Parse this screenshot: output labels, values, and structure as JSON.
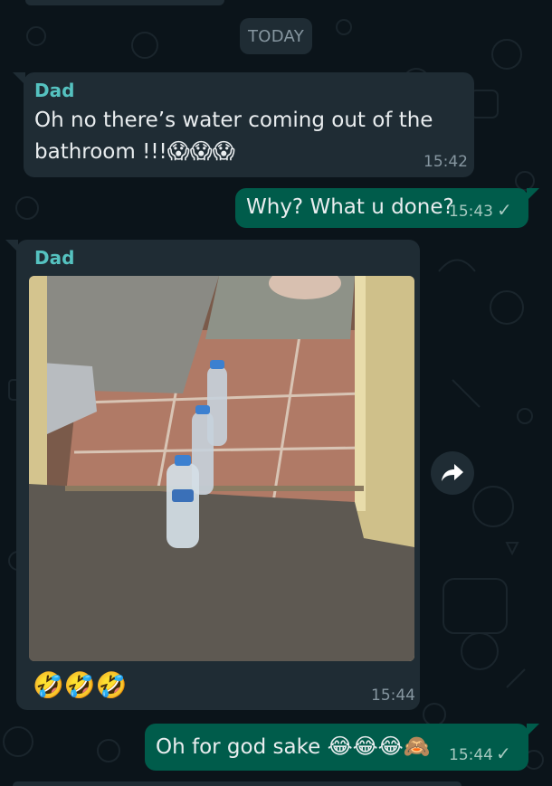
{
  "date_separator": "TODAY",
  "messages": [
    {
      "sender": "Dad",
      "text_line1": "Oh no there’s water coming out of the",
      "text_line2": "bathroom !!!",
      "emojis": "😱😱😱",
      "time": "15:42"
    },
    {
      "text": "Why? What u done?",
      "time": "15:43"
    },
    {
      "sender": "Dad",
      "photo": "image",
      "caption_emojis": "🤣🤣🤣",
      "time": "15:44"
    },
    {
      "text": "Oh for god sake",
      "emojis": "😂😂😂🙈",
      "time": "15:44"
    }
  ],
  "colors": {
    "background": "#0b141a",
    "incoming_bubble": "#1f2c34",
    "outgoing_bubble": "#005c4b",
    "sender_name": "#55c2c0"
  },
  "icons": {
    "read_receipt": "single-check-icon",
    "forward": "forward-arrow-icon"
  }
}
